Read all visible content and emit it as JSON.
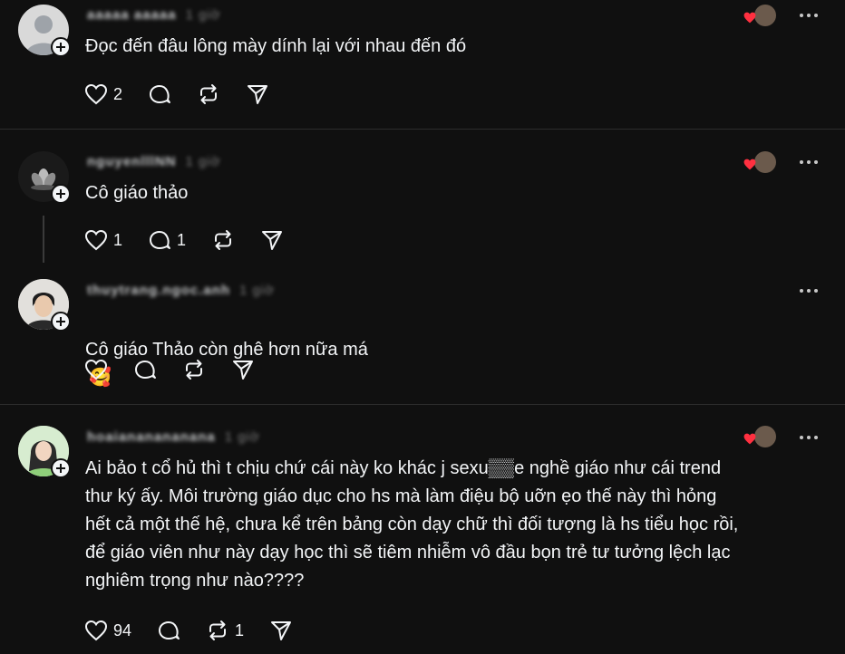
{
  "posts": [
    {
      "username": "aaaaa aaaaa",
      "time": "1 giờ",
      "text": "Đọc đến đâu lông mày dính lại với nhau đến đó",
      "likes": "2",
      "replies": "",
      "reposts": "",
      "liked_by_author": true
    },
    {
      "username": "nguyenlllNN",
      "time": "1 giờ",
      "text": "Cô giáo thảo",
      "likes": "1",
      "replies": "1",
      "reposts": "",
      "liked_by_author": true
    },
    {
      "username": "thuytrang.ngoc.anh",
      "time": "1 giờ",
      "text": "Cô giáo Thảo còn ghê hơn nữa má",
      "emoji": "🥰",
      "likes": "",
      "replies": "",
      "reposts": "",
      "liked_by_author": false
    },
    {
      "username": "hoaiananananana",
      "time": "1 giờ",
      "text": "Ai bảo t cổ hủ thì t chịu chứ cái này ko khác j sexu▒▒e nghề giáo như cái trend\nthư ký ấy. Môi trường giáo dục cho hs mà làm điệu bộ uỡn ẹo thế này thì hỏng\nhết cả một thế hệ, chưa kể trên bảng còn dạy chữ thì đối tượng là hs tiểu học rồi,\nđể giáo viên như này dạy học thì sẽ tiêm nhiễm vô đầu bọn trẻ tư tưởng lệch lạc\nnghiêm trọng như nào????",
      "likes": "94",
      "replies": "",
      "reposts": "1",
      "liked_by_author": true
    }
  ],
  "icons": {
    "like": "heart-outline-icon",
    "reply": "comment-bubble-icon",
    "repost": "repost-arrows-icon",
    "share": "send-paper-plane-icon",
    "more": "more-dots-icon",
    "follow": "plus-icon"
  },
  "colors": {
    "background": "#101010",
    "text": "#f3f5f7",
    "divider": "#2d2d2d",
    "heart": "#ff3040"
  }
}
